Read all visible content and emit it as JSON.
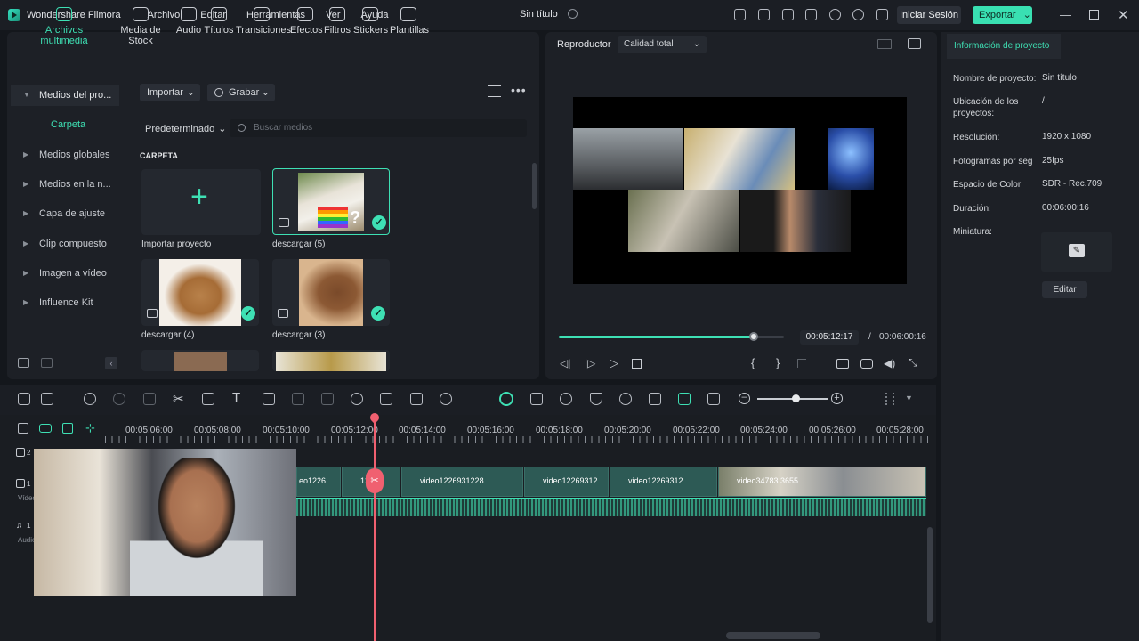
{
  "titlebar": {
    "app_name": "Wondershare Filmora",
    "menu": [
      "Archivo",
      "Editar",
      "Herramientas",
      "Ver",
      "Ayuda"
    ],
    "doc_title": "Sin título",
    "login": "Iniciar Sesión",
    "export": "Exportar"
  },
  "categories": [
    {
      "label": "Archivos multimedia",
      "icon": "media-icon"
    },
    {
      "label": "Media de Stock",
      "icon": "stock-icon"
    },
    {
      "label": "Audio",
      "icon": "music-icon"
    },
    {
      "label": "Títulos",
      "icon": "text-icon"
    },
    {
      "label": "Transiciones",
      "icon": "transition-icon"
    },
    {
      "label": "Efectos",
      "icon": "effects-icon"
    },
    {
      "label": "Filtros",
      "icon": "filter-icon"
    },
    {
      "label": "Stickers",
      "icon": "sticker-icon"
    },
    {
      "label": "Plantillas",
      "icon": "template-icon"
    }
  ],
  "sidebar": {
    "project": "Medios del pro...",
    "folder": "Carpeta",
    "items": [
      "Medios globales",
      "Medios en la n...",
      "Capa de ajuste",
      "Clip compuesto",
      "Imagen a vídeo",
      "Influence Kit"
    ]
  },
  "media_toolbar": {
    "import": "Importar",
    "record": "Grabar",
    "sort": "Predeterminado",
    "search_placeholder": "Buscar medios"
  },
  "folder_label": "CARPETA",
  "media_items": [
    {
      "label": "Importar proyecto"
    },
    {
      "label": "descargar (5)"
    },
    {
      "label": "descargar (4)"
    },
    {
      "label": "descargar (3)"
    }
  ],
  "player": {
    "tab": "Reproductor",
    "quality": "Calidad total",
    "current_time": "00:05:12:17",
    "separator": "/",
    "total_time": "00:06:00:16",
    "progress": 0.87
  },
  "project_info": {
    "tab": "Información de proyecto",
    "rows": [
      {
        "key": "Nombre de proyecto:",
        "value": "Sin título"
      },
      {
        "key": "Ubicación de los proyectos:",
        "value": "/"
      },
      {
        "key": "Resolución:",
        "value": "1920 x 1080"
      },
      {
        "key": "Fotogramas por seg",
        "value": "25fps"
      },
      {
        "key": "Espacio de Color:",
        "value": "SDR - Rec.709"
      },
      {
        "key": "Duración:",
        "value": "00:06:00:16"
      },
      {
        "key": "Miniatura:",
        "value": ""
      }
    ],
    "edit": "Editar"
  },
  "timeline": {
    "ticks": [
      "00:05:06:00",
      "00:05:08:00",
      "00:05:10:00",
      "00:05:12:00",
      "00:05:14:00",
      "00:05:16:00",
      "00:05:18:00",
      "00:05:20:00",
      "00:05:22:00",
      "00:05:24:00",
      "00:05:26:00",
      "00:05:28:00"
    ],
    "tracks": [
      {
        "label": "2"
      },
      {
        "label": "1",
        "sub": "Vídeo"
      },
      {
        "label": "1",
        "sub": "Audio"
      }
    ],
    "clips": [
      "eo1226...",
      "12...",
      "video1226931228",
      "video12269312...",
      "video12269312...",
      "video34783 3655"
    ]
  }
}
